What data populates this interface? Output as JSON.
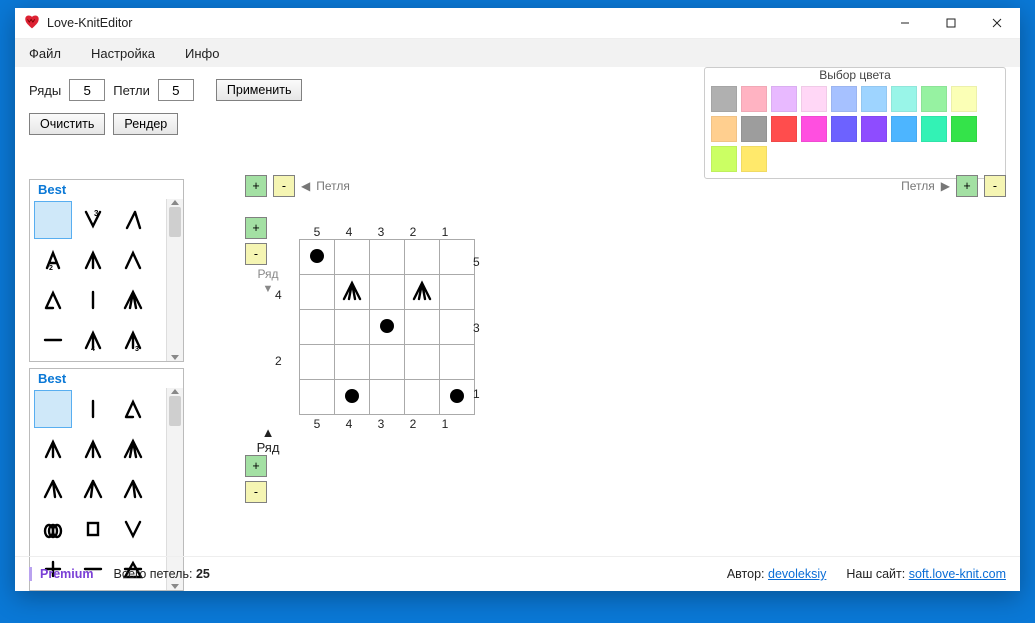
{
  "window": {
    "title": "Love-KnitEditor"
  },
  "menu": {
    "file": "Файл",
    "settings": "Настройка",
    "info": "Инфо"
  },
  "toolbar": {
    "rows_label": "Ряды",
    "rows_value": "5",
    "loops_label": "Петли",
    "loops_value": "5",
    "apply": "Применить",
    "clear": "Очистить",
    "render": "Рендер"
  },
  "colorpicker": {
    "title": "Выбор цвета",
    "colors": [
      "#b0b0b0",
      "#ffb3c2",
      "#e8b9ff",
      "#ffd7f6",
      "#a6c1ff",
      "#9ed4ff",
      "#99f5e8",
      "#96f2a1",
      "#fbffb6",
      "#ffcf8f",
      "#9d9d9d",
      "#ff4d4d",
      "#ff4fe0",
      "#6d62ff",
      "#8e4cff",
      "#4db5ff",
      "#33f2b5",
      "#34e34a",
      "#cbff63",
      "#ffe96b"
    ]
  },
  "palette_header": "Best",
  "loopctl": {
    "left_label": "Петля",
    "right_label": "Петля",
    "row_label": "Ряд",
    "plus": "+",
    "minus": "-"
  },
  "grid": {
    "cols": [
      "5",
      "4",
      "3",
      "2",
      "1"
    ],
    "rows_right": [
      "5",
      "",
      "3",
      "",
      "1"
    ],
    "rows_left": [
      "",
      "4",
      "",
      "2",
      ""
    ],
    "bottom_cols": [
      "5",
      "4",
      "3",
      "2",
      "1"
    ],
    "cells": [
      [
        "dot",
        "",
        "",
        "",
        ""
      ],
      [
        "",
        "tri",
        "",
        "tri",
        ""
      ],
      [
        "",
        "",
        "dot",
        "",
        ""
      ],
      [
        "",
        "",
        "",
        "",
        ""
      ],
      [
        "",
        "dot",
        "",
        "",
        "dot"
      ]
    ]
  },
  "footer": {
    "premium": "Premium",
    "total_label": "Всего петель:",
    "total_value": "25",
    "author_label": "Автор:",
    "author_link": "devoleksiy",
    "site_label": "Наш сайт:",
    "site_link": "soft.love-knit.com"
  }
}
